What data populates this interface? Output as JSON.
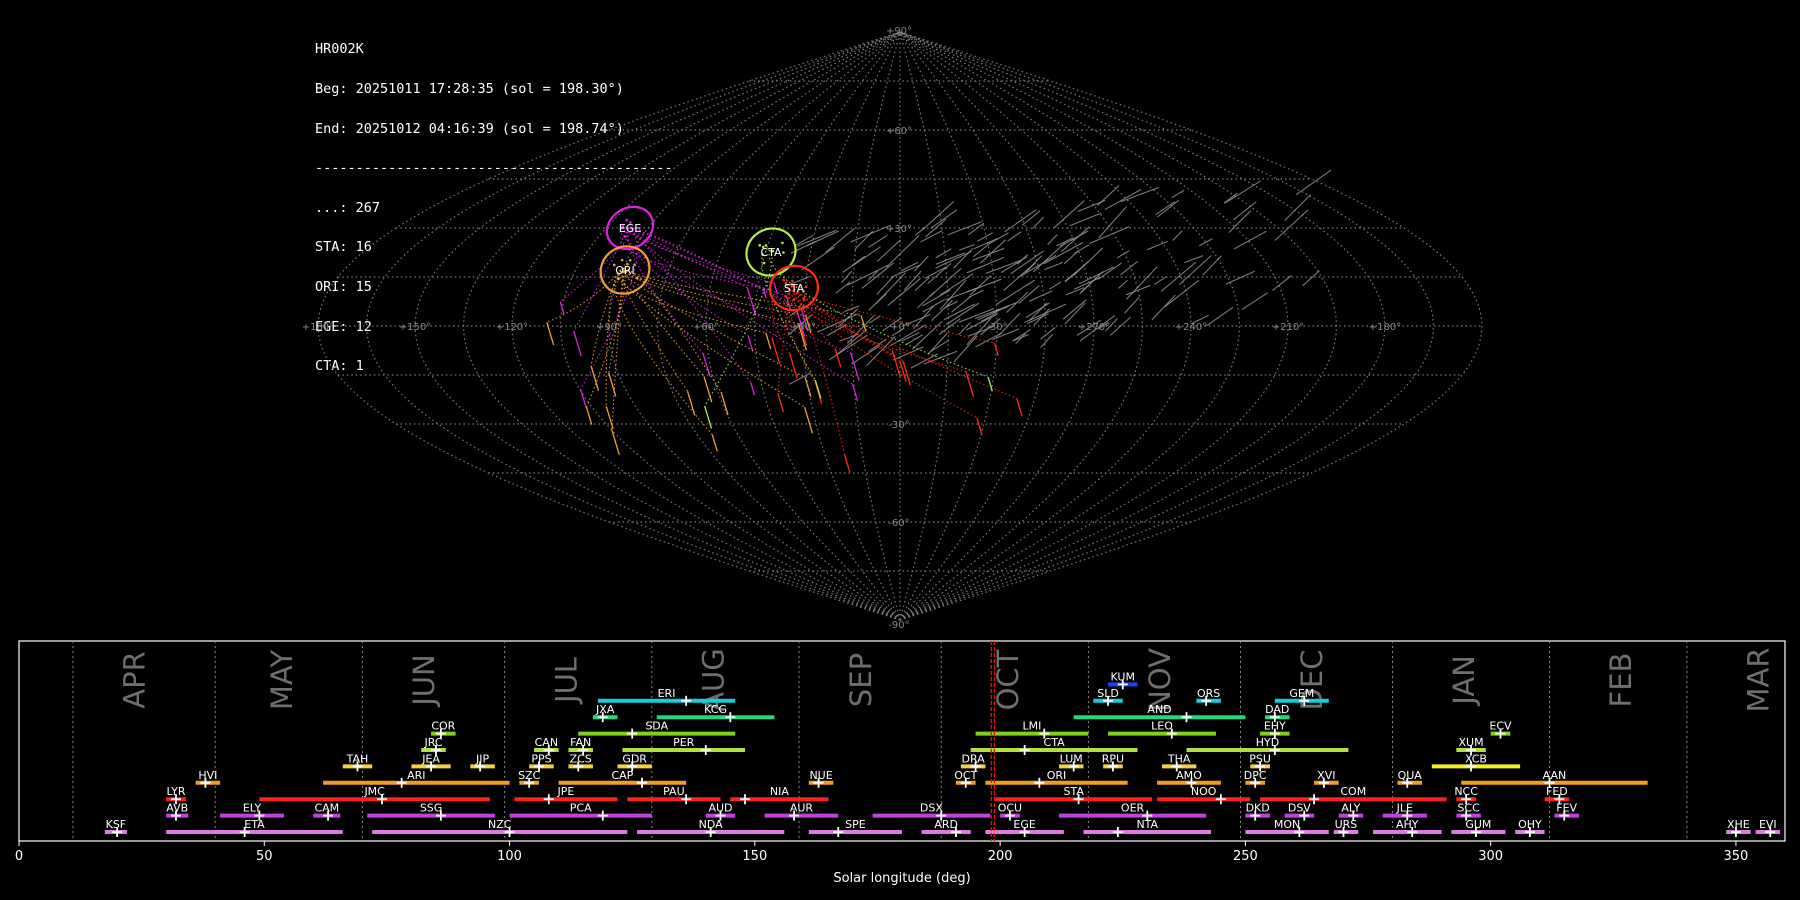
{
  "info": {
    "station": "HR002K",
    "beg": "Beg: 20251011 17:28:35 (sol = 198.30°)",
    "end": "End: 20251012 04:16:39 (sol = 198.74°)",
    "separator": "--------------------------------------------",
    "counts": [
      "...: 267",
      "STA: 16",
      "ORI: 15",
      "EGE: 12",
      "CTA: 1"
    ]
  },
  "sky_map": {
    "projection": "sinusoidal",
    "lon_labels": [
      "+180°",
      "+150°",
      "+120°",
      "+90°",
      "+60°",
      "+30°",
      "+0°",
      "-30°",
      "+270°",
      "+240°",
      "+210°",
      "+180°"
    ],
    "lat_labels": [
      "+90°",
      "+60°",
      "+30°",
      "-30°",
      "-60°",
      "-90°"
    ],
    "radiants": [
      {
        "name": "EGE",
        "color": "#e020e0"
      },
      {
        "name": "ORI",
        "color": "#f0a030"
      },
      {
        "name": "CTA",
        "color": "#b0f040"
      },
      {
        "name": "STA",
        "color": "#ff2a10"
      }
    ]
  },
  "timeline": {
    "xlabel": "Solar longitude (deg)",
    "xlim": [
      0,
      360
    ],
    "xticks": [
      0,
      50,
      100,
      150,
      200,
      250,
      300,
      350
    ],
    "current_sol": 198.52,
    "current_color": "#ff0000",
    "months": [
      {
        "label": "APR",
        "pos": 24,
        "sep": 11
      },
      {
        "label": "MAY",
        "pos": 54,
        "sep": 40
      },
      {
        "label": "JUN",
        "pos": 83,
        "sep": 70
      },
      {
        "label": "JUL",
        "pos": 112,
        "sep": 99
      },
      {
        "label": "AUG",
        "pos": 142,
        "sep": 129
      },
      {
        "label": "SEP",
        "pos": 172,
        "sep": 159
      },
      {
        "label": "OCT",
        "pos": 202,
        "sep": 188
      },
      {
        "label": "NOV",
        "pos": 233,
        "sep": 218
      },
      {
        "label": "DEC",
        "pos": 264,
        "sep": 249
      },
      {
        "label": "JAN",
        "pos": 295,
        "sep": 280
      },
      {
        "label": "FEB",
        "pos": 327,
        "sep": 312
      },
      {
        "label": "MAR",
        "pos": 355,
        "sep": 340
      }
    ],
    "showers": [
      {
        "code": "KSF",
        "start": 17.5,
        "end": 22,
        "peak": 20,
        "row": 0,
        "color": "#e07ae0"
      },
      {
        "code": "ETA",
        "start": 30,
        "end": 66,
        "peak": 46,
        "row": 0,
        "color": "#e07ae0"
      },
      {
        "code": "NZC",
        "start": 72,
        "end": 124,
        "peak": 100,
        "row": 0,
        "color": "#e07ae0"
      },
      {
        "code": "NDA",
        "start": 126,
        "end": 156,
        "peak": 141,
        "row": 0,
        "color": "#e07ae0"
      },
      {
        "code": "SPE",
        "start": 161,
        "end": 180,
        "peak": 167,
        "row": 0,
        "color": "#e07ae0"
      },
      {
        "code": "ARD",
        "start": 184,
        "end": 194,
        "peak": 191,
        "row": 0,
        "color": "#e07ae0"
      },
      {
        "code": "EGE",
        "start": 197,
        "end": 213,
        "peak": 205,
        "row": 0,
        "color": "#e07ae0"
      },
      {
        "code": "NTA",
        "start": 217,
        "end": 243,
        "peak": 224,
        "row": 0,
        "color": "#e07ae0"
      },
      {
        "code": "MON",
        "start": 250,
        "end": 267,
        "peak": 261,
        "row": 0,
        "color": "#e07ae0"
      },
      {
        "code": "URS",
        "start": 268,
        "end": 273,
        "peak": 270,
        "row": 0,
        "color": "#e07ae0"
      },
      {
        "code": "AHY",
        "start": 276,
        "end": 290,
        "peak": 284,
        "row": 0,
        "color": "#e07ae0"
      },
      {
        "code": "GUM",
        "start": 292,
        "end": 303,
        "peak": 297,
        "row": 0,
        "color": "#e07ae0"
      },
      {
        "code": "OHY",
        "start": 305,
        "end": 311,
        "peak": 308,
        "row": 0,
        "color": "#e07ae0"
      },
      {
        "code": "XHE",
        "start": 348,
        "end": 353,
        "peak": 350,
        "row": 0,
        "color": "#e07ae0"
      },
      {
        "code": "EVI",
        "start": 354,
        "end": 359,
        "peak": 357,
        "row": 0,
        "color": "#e07ae0"
      },
      {
        "code": "AVB",
        "start": 30,
        "end": 34.5,
        "peak": 32,
        "row": 1,
        "color": "#c040e0"
      },
      {
        "code": "ELY",
        "start": 41,
        "end": 54,
        "peak": 49,
        "row": 1,
        "color": "#c040e0"
      },
      {
        "code": "CAM",
        "start": 60,
        "end": 65.5,
        "peak": 63,
        "row": 1,
        "color": "#c040e0"
      },
      {
        "code": "SSG",
        "start": 71,
        "end": 97,
        "peak": 86,
        "row": 1,
        "color": "#c040e0"
      },
      {
        "code": "PCA",
        "start": 100,
        "end": 129,
        "peak": 119,
        "row": 1,
        "color": "#c040e0"
      },
      {
        "code": "AUD",
        "start": 140,
        "end": 146,
        "peak": 143,
        "row": 1,
        "color": "#c040e0"
      },
      {
        "code": "AUR",
        "start": 152,
        "end": 167,
        "peak": 158,
        "row": 1,
        "color": "#c040e0"
      },
      {
        "code": "DSX",
        "start": 174,
        "end": 198,
        "peak": 188,
        "row": 1,
        "color": "#c040e0"
      },
      {
        "code": "OCU",
        "start": 200,
        "end": 204,
        "peak": 202,
        "row": 1,
        "color": "#c040e0"
      },
      {
        "code": "OER",
        "start": 212,
        "end": 242,
        "peak": 230,
        "row": 1,
        "color": "#c040e0"
      },
      {
        "code": "DKD",
        "start": 250,
        "end": 255,
        "peak": 252,
        "row": 1,
        "color": "#c040e0"
      },
      {
        "code": "DSV",
        "start": 258,
        "end": 264,
        "peak": 262,
        "row": 1,
        "color": "#c040e0"
      },
      {
        "code": "ALY",
        "start": 269,
        "end": 274,
        "peak": 272,
        "row": 1,
        "color": "#c040e0"
      },
      {
        "code": "JLE",
        "start": 278,
        "end": 287,
        "peak": 283,
        "row": 1,
        "color": "#c040e0"
      },
      {
        "code": "SCC",
        "start": 293,
        "end": 298,
        "peak": 295,
        "row": 1,
        "color": "#c040e0"
      },
      {
        "code": "FEV",
        "start": 313,
        "end": 318,
        "peak": 315,
        "row": 1,
        "color": "#c040e0"
      },
      {
        "code": "LYR",
        "start": 30,
        "end": 34,
        "peak": 32,
        "row": 2,
        "color": "#ff2020"
      },
      {
        "code": "JMC",
        "start": 49,
        "end": 96,
        "peak": 74,
        "row": 2,
        "color": "#ff2020"
      },
      {
        "code": "JPE",
        "start": 101,
        "end": 122,
        "peak": 108,
        "row": 2,
        "color": "#ff2020"
      },
      {
        "code": "PAU",
        "start": 124,
        "end": 143,
        "peak": 136,
        "row": 2,
        "color": "#ff2020"
      },
      {
        "code": "NIA",
        "start": 145,
        "end": 165,
        "peak": 148,
        "row": 2,
        "color": "#ff2020"
      },
      {
        "code": "STA",
        "start": 199,
        "end": 231,
        "peak": 216,
        "row": 2,
        "color": "#ff2020"
      },
      {
        "code": "NOO",
        "start": 232,
        "end": 251,
        "peak": 245,
        "row": 2,
        "color": "#ff2020"
      },
      {
        "code": "COM",
        "start": 253,
        "end": 291,
        "peak": 264,
        "row": 2,
        "color": "#ff2020"
      },
      {
        "code": "NCC",
        "start": 293,
        "end": 297,
        "peak": 295,
        "row": 2,
        "color": "#ff2020"
      },
      {
        "code": "FED",
        "start": 311,
        "end": 316,
        "peak": 314,
        "row": 2,
        "color": "#ff2020"
      },
      {
        "code": "HVI",
        "start": 36,
        "end": 41,
        "peak": 38,
        "row": 3,
        "color": "#f0a020"
      },
      {
        "code": "ARI",
        "start": 62,
        "end": 100,
        "peak": 78,
        "row": 3,
        "color": "#f0a020"
      },
      {
        "code": "SZC",
        "start": 102,
        "end": 106,
        "peak": 104,
        "row": 3,
        "color": "#f0a020"
      },
      {
        "code": "CAP",
        "start": 110,
        "end": 136,
        "peak": 127,
        "row": 3,
        "color": "#f0a020"
      },
      {
        "code": "NUE",
        "start": 161,
        "end": 166,
        "peak": 163,
        "row": 3,
        "color": "#f0a020"
      },
      {
        "code": "OCT",
        "start": 191,
        "end": 195,
        "peak": 193,
        "row": 3,
        "color": "#f0a020"
      },
      {
        "code": "ORI",
        "start": 197,
        "end": 226,
        "peak": 208,
        "row": 3,
        "color": "#f0a020"
      },
      {
        "code": "AMO",
        "start": 232,
        "end": 245,
        "peak": 239,
        "row": 3,
        "color": "#f0a020"
      },
      {
        "code": "DPC",
        "start": 250,
        "end": 254,
        "peak": 252,
        "row": 3,
        "color": "#f0a020"
      },
      {
        "code": "XVI",
        "start": 264,
        "end": 269,
        "peak": 266,
        "row": 3,
        "color": "#f0a020"
      },
      {
        "code": "QUA",
        "start": 281,
        "end": 286,
        "peak": 283,
        "row": 3,
        "color": "#f0a020"
      },
      {
        "code": "AAN",
        "start": 294,
        "end": 332,
        "peak": 312,
        "row": 3,
        "color": "#f0a020"
      },
      {
        "code": "TAH",
        "start": 66,
        "end": 72,
        "peak": 69,
        "row": 4,
        "color": "#f5d040"
      },
      {
        "code": "JEA",
        "start": 80,
        "end": 88,
        "peak": 84,
        "row": 4,
        "color": "#f5d040"
      },
      {
        "code": "JIP",
        "start": 92,
        "end": 97,
        "peak": 94,
        "row": 4,
        "color": "#f5d040"
      },
      {
        "code": "PPS",
        "start": 104,
        "end": 109,
        "peak": 106,
        "row": 4,
        "color": "#f5d040"
      },
      {
        "code": "ZCS",
        "start": 112,
        "end": 117,
        "peak": 114,
        "row": 4,
        "color": "#f5d040"
      },
      {
        "code": "GDR",
        "start": 122,
        "end": 129,
        "peak": 125,
        "row": 4,
        "color": "#f5d040"
      },
      {
        "code": "DRA",
        "start": 192,
        "end": 197,
        "peak": 195,
        "row": 4,
        "color": "#f5d040"
      },
      {
        "code": "LUM",
        "start": 212,
        "end": 217,
        "peak": 215,
        "row": 4,
        "color": "#f5d040"
      },
      {
        "code": "RPU",
        "start": 221,
        "end": 225,
        "peak": 223,
        "row": 4,
        "color": "#f5d040"
      },
      {
        "code": "THA",
        "start": 233,
        "end": 240,
        "peak": 236,
        "row": 4,
        "color": "#f5d040"
      },
      {
        "code": "PSU",
        "start": 251,
        "end": 255,
        "peak": 253,
        "row": 4,
        "color": "#f5d040"
      },
      {
        "code": "XCB",
        "start": 288,
        "end": 306,
        "peak": 296,
        "row": 4,
        "color": "#f5f020"
      },
      {
        "code": "JRC",
        "start": 82,
        "end": 87,
        "peak": 85,
        "row": 5,
        "color": "#b0e040"
      },
      {
        "code": "CAN",
        "start": 105,
        "end": 110,
        "peak": 108,
        "row": 5,
        "color": "#b0e040"
      },
      {
        "code": "FAN",
        "start": 112,
        "end": 117,
        "peak": 115,
        "row": 5,
        "color": "#b0e040"
      },
      {
        "code": "PER",
        "start": 123,
        "end": 148,
        "peak": 140,
        "row": 5,
        "color": "#b0e040"
      },
      {
        "code": "CTA",
        "start": 194,
        "end": 228,
        "peak": 205,
        "row": 5,
        "color": "#b0e040"
      },
      {
        "code": "HYD",
        "start": 238,
        "end": 271,
        "peak": 256,
        "row": 5,
        "color": "#b0e040"
      },
      {
        "code": "XUM",
        "start": 293,
        "end": 299,
        "peak": 296,
        "row": 5,
        "color": "#b0e040"
      },
      {
        "code": "COR",
        "start": 84,
        "end": 89,
        "peak": 86,
        "row": 6,
        "color": "#80d020"
      },
      {
        "code": "SDA",
        "start": 114,
        "end": 146,
        "peak": 125,
        "row": 6,
        "color": "#80d020"
      },
      {
        "code": "LMI",
        "start": 195,
        "end": 218,
        "peak": 209,
        "row": 6,
        "color": "#80d020"
      },
      {
        "code": "LEO",
        "start": 222,
        "end": 244,
        "peak": 235,
        "row": 6,
        "color": "#80d020"
      },
      {
        "code": "EHY",
        "start": 253,
        "end": 259,
        "peak": 256,
        "row": 6,
        "color": "#80d020"
      },
      {
        "code": "ECV",
        "start": 300,
        "end": 304,
        "peak": 302,
        "row": 6,
        "color": "#80d020"
      },
      {
        "code": "JXA",
        "start": 117,
        "end": 122,
        "peak": 119,
        "row": 7,
        "color": "#20d880"
      },
      {
        "code": "KCG",
        "start": 130,
        "end": 154,
        "peak": 145,
        "row": 7,
        "color": "#20d880"
      },
      {
        "code": "AND",
        "start": 215,
        "end": 250,
        "peak": 238,
        "row": 7,
        "color": "#20d880"
      },
      {
        "code": "DAD",
        "start": 254,
        "end": 259,
        "peak": 256,
        "row": 7,
        "color": "#20d880"
      },
      {
        "code": "ERI",
        "start": 118,
        "end": 146,
        "peak": 136,
        "row": 8,
        "color": "#10d0e0"
      },
      {
        "code": "SLD",
        "start": 219,
        "end": 225,
        "peak": 222,
        "row": 8,
        "color": "#10d0e0"
      },
      {
        "code": "ORS",
        "start": 240,
        "end": 245,
        "peak": 242,
        "row": 8,
        "color": "#10d0e0"
      },
      {
        "code": "GEM",
        "start": 256,
        "end": 267,
        "peak": 262,
        "row": 8,
        "color": "#10d0e0"
      },
      {
        "code": "KUM",
        "start": 222,
        "end": 228,
        "peak": 225,
        "row": 9,
        "color": "#2040ff"
      }
    ]
  }
}
